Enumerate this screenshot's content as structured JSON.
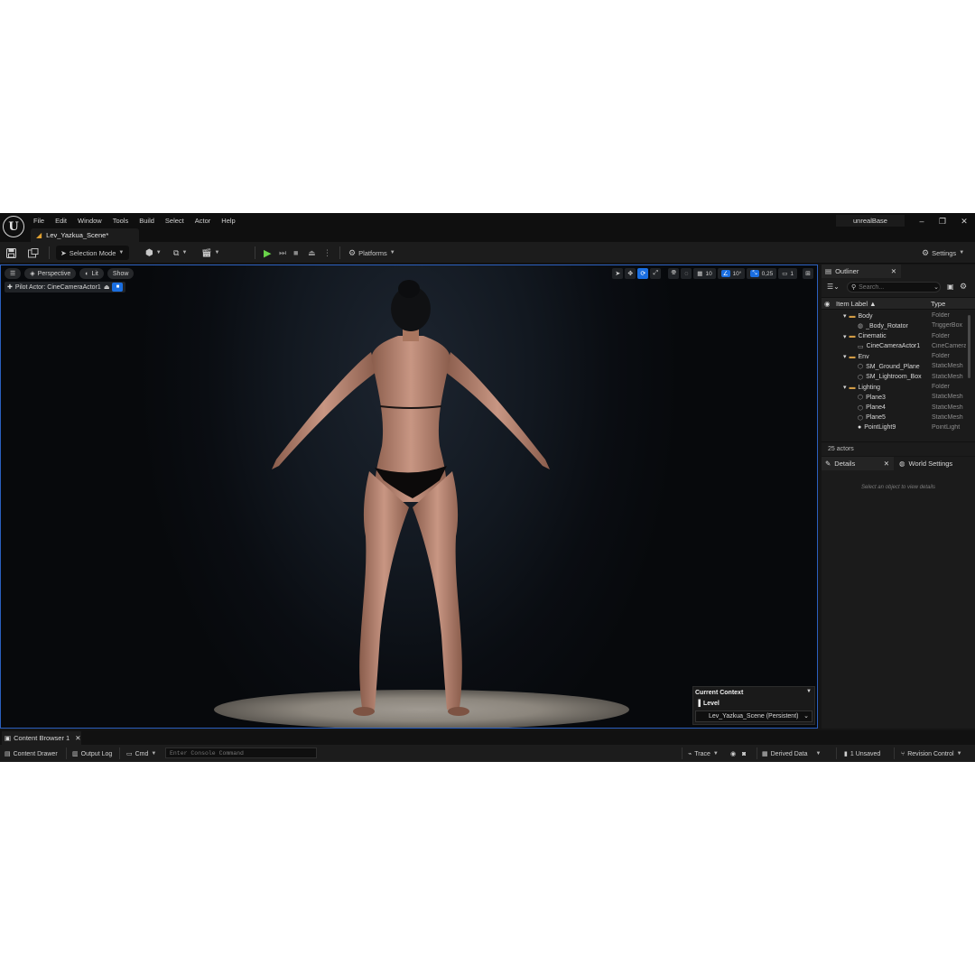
{
  "app": {
    "project_name": "unrealBase",
    "document_tab": "Lev_Yazkua_Scene*",
    "menu": [
      "File",
      "Edit",
      "Window",
      "Tools",
      "Build",
      "Select",
      "Actor",
      "Help"
    ]
  },
  "toolbar": {
    "selection_mode": "Selection Mode",
    "platforms": "Platforms",
    "settings": "Settings"
  },
  "viewport": {
    "perspective": "Perspective",
    "lit": "Lit",
    "show": "Show",
    "pilot_actor": "Pilot Actor: CineCameraActor1",
    "grid_snap": "10",
    "rotation_snap": "10°",
    "scale_snap": "0,25",
    "camera_speed": "1"
  },
  "context": {
    "title": "Current Context",
    "level_label": "Level",
    "level_value": "Lev_Yazkua_Scene (Persistent)"
  },
  "outliner": {
    "tab": "Outliner",
    "search_placeholder": "Search...",
    "col_label": "Item Label ▲",
    "col_type": "Type",
    "rows": [
      {
        "label": "Body",
        "type": "Folder"
      },
      {
        "label": "_Body_Rotator",
        "type": "TriggerBox"
      },
      {
        "label": "Cinematic",
        "type": "Folder"
      },
      {
        "label": "CineCameraActor1",
        "type": "CineCamera"
      },
      {
        "label": "Env",
        "type": "Folder"
      },
      {
        "label": "SM_Ground_Plane",
        "type": "StaticMesh"
      },
      {
        "label": "SM_Lightroom_Box",
        "type": "StaticMesh"
      },
      {
        "label": "Lighting",
        "type": "Folder"
      },
      {
        "label": "Plane3",
        "type": "StaticMesh"
      },
      {
        "label": "Plane4",
        "type": "StaticMesh"
      },
      {
        "label": "Plane5",
        "type": "StaticMesh"
      },
      {
        "label": "PointLight9",
        "type": "PointLight"
      }
    ],
    "actor_count": "25 actors"
  },
  "details": {
    "tab": "Details",
    "world_settings_tab": "World Settings",
    "empty_message": "Select an object to view details"
  },
  "bottom": {
    "content_browser_tab": "Content Browser 1",
    "content_drawer": "Content Drawer",
    "output_log": "Output Log",
    "cmd": "Cmd",
    "console_placeholder": "Enter Console Command",
    "trace": "Trace",
    "derived_data": "Derived Data",
    "unsaved": "1 Unsaved",
    "revision_control": "Revision Control"
  },
  "colors": {
    "accent_blue": "#1a6ee0",
    "play_green": "#6ad44a",
    "folder_orange": "#d19b45"
  }
}
